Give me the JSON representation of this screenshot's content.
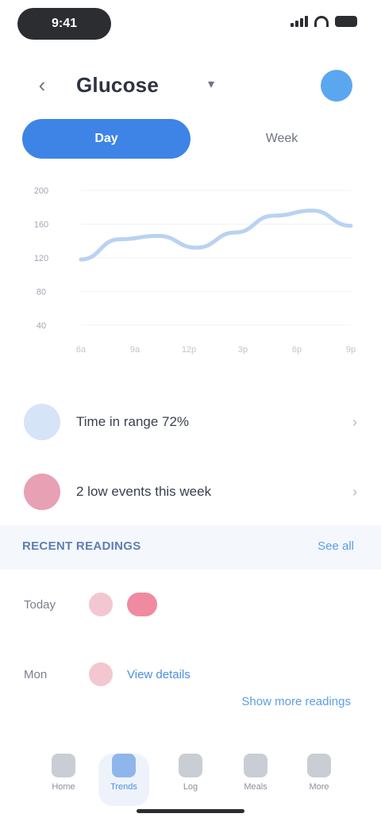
{
  "status_bar": {
    "time": "9:41"
  },
  "header": {
    "back_icon": "chevron-left-icon",
    "title": "Glucose",
    "avatar_color": "#5aa7f0"
  },
  "tabs": [
    {
      "label": "Day",
      "active": true
    },
    {
      "label": "Week",
      "active": false
    }
  ],
  "chart_data": {
    "type": "line",
    "x": [
      "6a",
      "9a",
      "12p",
      "3p",
      "6p",
      "9p"
    ],
    "series": [
      {
        "values": [
          118,
          142,
          146,
          132,
          150,
          170,
          176,
          158
        ]
      }
    ],
    "ylabel_ticks": [
      "200",
      "160",
      "120",
      "80",
      "40"
    ],
    "ylim": [
      40,
      200
    ],
    "grid": true,
    "color": "#b9d2f3"
  },
  "info_rows": [
    {
      "label": "Time in range 72%",
      "icon": "target-icon",
      "icon_color": "#d6e4f7"
    },
    {
      "label": "2 low events this week",
      "icon": "alert-icon",
      "icon_color": "#e8a0b4"
    }
  ],
  "section": {
    "title": "RECENT READINGS",
    "link": "See all"
  },
  "readings": [
    {
      "date": "Today",
      "badges": [
        {
          "text": "",
          "color": "#f3c7cf"
        },
        {
          "text": "",
          "color": "#f08aa0"
        }
      ],
      "link": ""
    },
    {
      "date": "Mon",
      "badges": [
        {
          "text": "",
          "color": "#f3c7cf"
        }
      ],
      "link": "View details"
    }
  ],
  "footer_link": "Show more readings",
  "nav": [
    {
      "label": "Home",
      "icon": "home-icon",
      "active": false
    },
    {
      "label": "Trends",
      "icon": "chart-icon",
      "active": true
    },
    {
      "label": "Log",
      "icon": "plus-icon",
      "active": false
    },
    {
      "label": "Meals",
      "icon": "food-icon",
      "active": false
    },
    {
      "label": "More",
      "icon": "menu-icon",
      "active": false
    }
  ]
}
